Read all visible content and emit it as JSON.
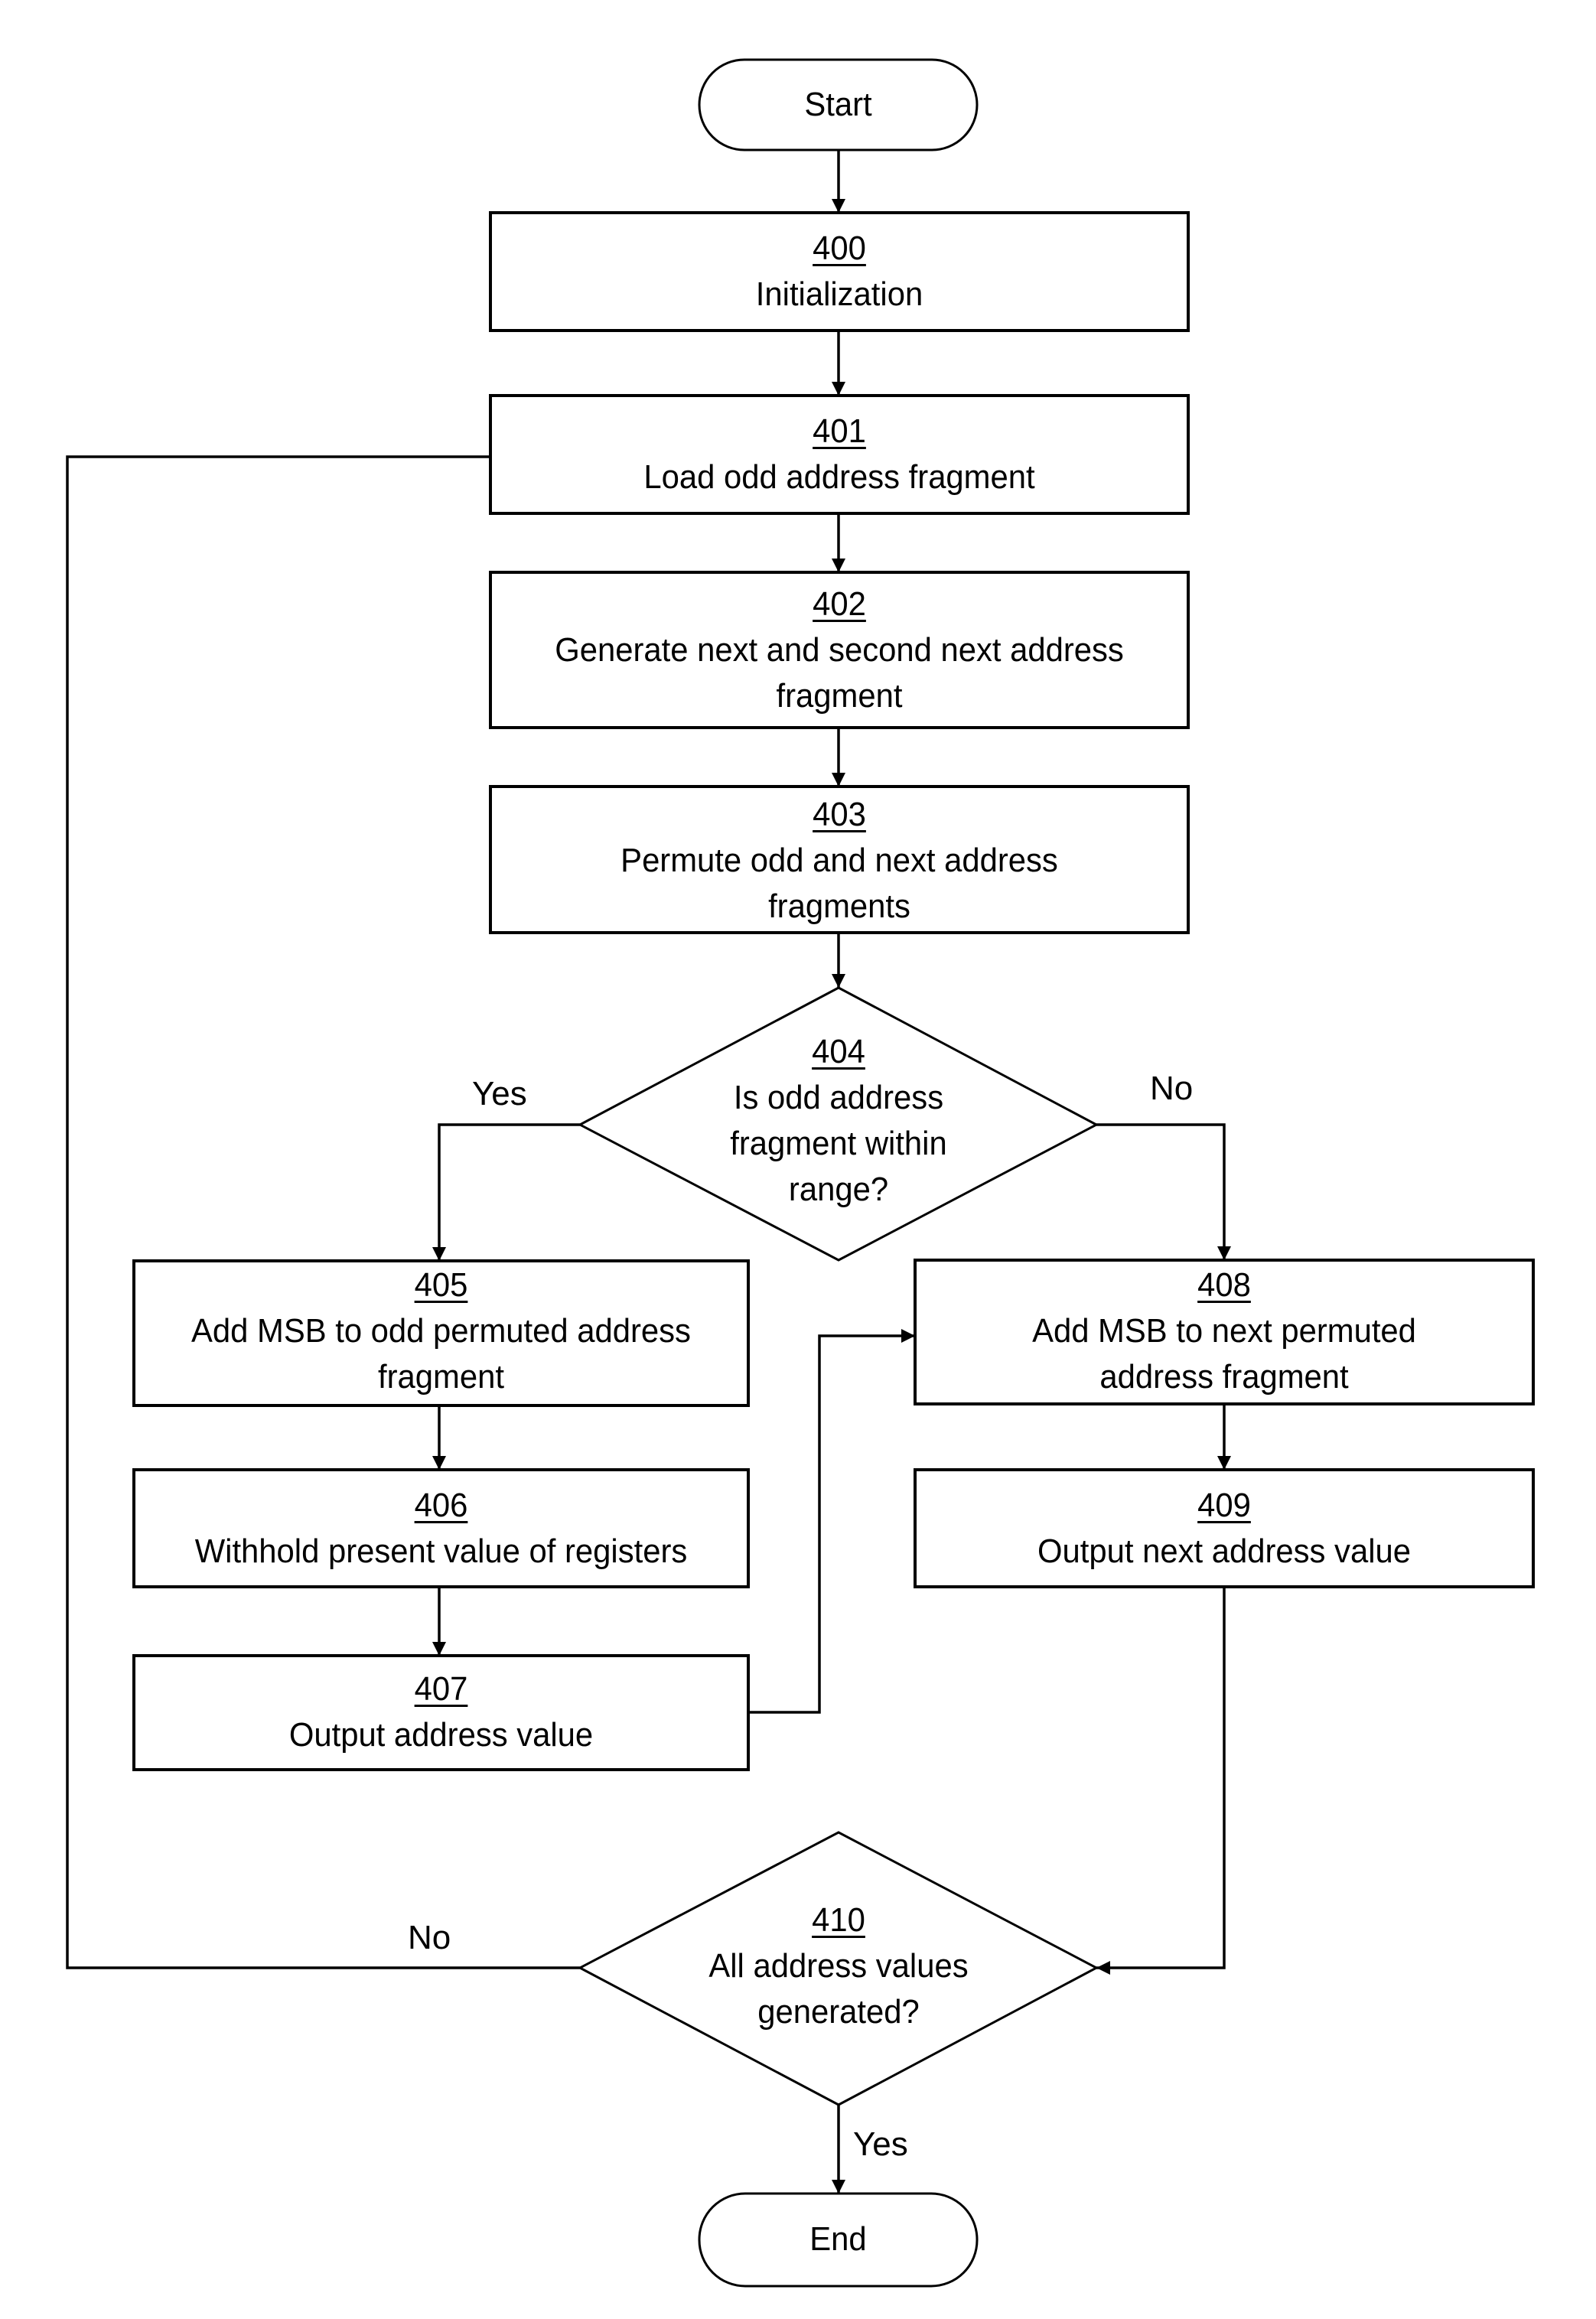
{
  "diagram": {
    "type": "flowchart",
    "terminals": {
      "start": "Start",
      "end": "End"
    },
    "steps": [
      {
        "id": "400",
        "text": "Initialization"
      },
      {
        "id": "401",
        "text": "Load odd address fragment"
      },
      {
        "id": "402",
        "text": "Generate next and second next address fragment"
      },
      {
        "id": "403",
        "text": "Permute odd and next address fragments"
      },
      {
        "id": "405",
        "text": "Add MSB to odd permuted address fragment"
      },
      {
        "id": "406",
        "text": "Withhold present value of registers"
      },
      {
        "id": "407",
        "text": "Output address value"
      },
      {
        "id": "408",
        "text": "Add MSB to next permuted address fragment"
      },
      {
        "id": "409",
        "text": "Output next address value"
      }
    ],
    "decisions": [
      {
        "id": "404",
        "text": "Is odd address fragment within range?",
        "yes": "405",
        "no": "408"
      },
      {
        "id": "410",
        "text": "All address values generated?",
        "yes": "End",
        "no": "401"
      }
    ],
    "edge_labels": {
      "d404_yes": "Yes",
      "d404_no": "No",
      "d410_no": "No",
      "d410_yes": "Yes"
    },
    "edges": [
      [
        "Start",
        "400"
      ],
      [
        "400",
        "401"
      ],
      [
        "401",
        "402"
      ],
      [
        "402",
        "403"
      ],
      [
        "403",
        "404"
      ],
      [
        "404",
        "405",
        "Yes"
      ],
      [
        "404",
        "408",
        "No"
      ],
      [
        "405",
        "406"
      ],
      [
        "406",
        "407"
      ],
      [
        "407",
        "408"
      ],
      [
        "408",
        "409"
      ],
      [
        "409",
        "410"
      ],
      [
        "410",
        "401",
        "No"
      ],
      [
        "410",
        "End",
        "Yes"
      ]
    ]
  }
}
